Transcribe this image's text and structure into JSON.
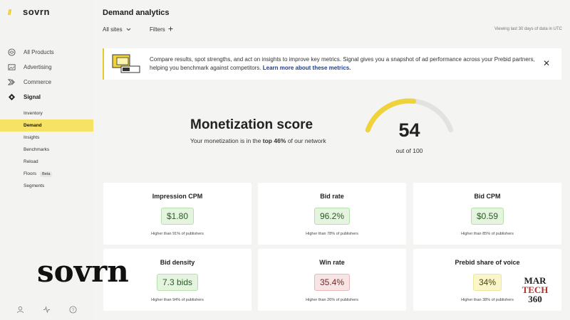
{
  "app": {
    "logo_mark": "//",
    "logo_text": "sovrn"
  },
  "sidebar": {
    "main_items": [
      {
        "label": "All Products",
        "icon": "layers-icon"
      },
      {
        "label": "Advertising",
        "icon": "image-icon"
      },
      {
        "label": "Commerce",
        "icon": "commerce-icon"
      },
      {
        "label": "Signal",
        "icon": "signal-diamond-icon"
      }
    ],
    "sub_items": [
      {
        "label": "Inventory"
      },
      {
        "label": "Demand",
        "active": true
      },
      {
        "label": "Insights"
      },
      {
        "label": "Benchmarks"
      },
      {
        "label": "Reload"
      },
      {
        "label": "Floors",
        "badge": "Beta"
      },
      {
        "label": "Segments"
      }
    ],
    "bottom_icons": [
      "user-icon",
      "activity-icon",
      "help-icon"
    ]
  },
  "header": {
    "title": "Demand analytics",
    "site_filter": "All sites",
    "filters_label": "Filters",
    "viewing_text": "Viewing last 30 days of data in UTC"
  },
  "banner": {
    "text": "Compare results, spot strengths, and act on insights to improve key metrics. Signal gives you a snapshot of ad performance across your Prebid partners, helping you benchmark against competitors.",
    "link": "Learn more about these metrics."
  },
  "score": {
    "title": "Monetization score",
    "desc_prefix": "Your monetization is in the",
    "desc_highlight": "top 46%",
    "desc_suffix": "of our network",
    "value": "54",
    "out_of": "out of 100",
    "fraction": 0.54
  },
  "metrics": [
    {
      "title": "Impression CPM",
      "value": "$1.80",
      "note": "Higher than 91% of publishers",
      "tone": "green"
    },
    {
      "title": "Bid rate",
      "value": "96.2%",
      "note": "Higher than 78% of publishers",
      "tone": "green"
    },
    {
      "title": "Bid CPM",
      "value": "$0.59",
      "note": "Higher than 85% of publishers",
      "tone": "green"
    },
    {
      "title": "Bid density",
      "value": "7.3 bids",
      "note": "Higher than 94% of publishers",
      "tone": "green"
    },
    {
      "title": "Win rate",
      "value": "35.4%",
      "note": "Higher than 26% of publishers",
      "tone": "red"
    },
    {
      "title": "Prebid share of voice",
      "value": "34%",
      "note": "Higher than 38% of publishers",
      "tone": "yellow"
    }
  ],
  "watermarks": {
    "sovrn": "sovrn",
    "martech_1": "MAR",
    "martech_2": "TECH",
    "martech_3": "360"
  },
  "colors": {
    "accent": "#f6e366",
    "gauge_fill": "#f0d33a",
    "gauge_track": "#e2e2e0",
    "link": "#1c3f8c"
  }
}
